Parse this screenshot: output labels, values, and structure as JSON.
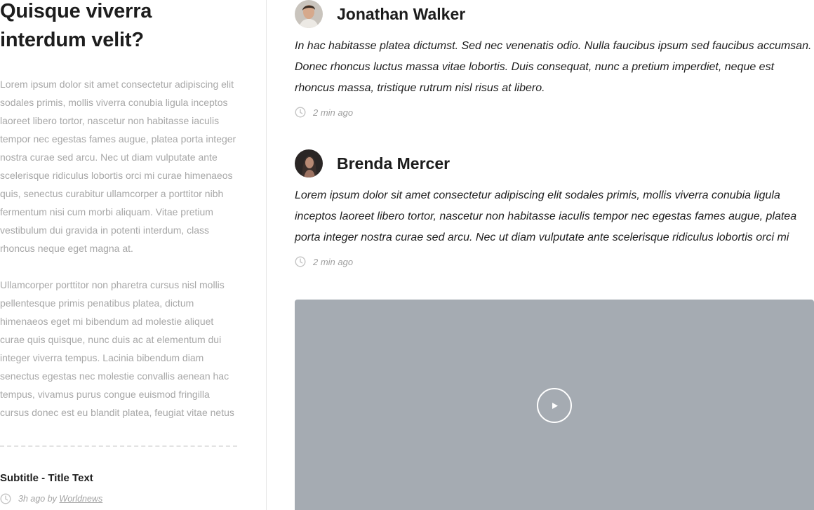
{
  "sidebar": {
    "title": "Quisque viverra interdum velit?",
    "paragraph1": "Lorem ipsum dolor sit amet consectetur adipiscing elit sodales primis, mollis viverra conubia ligula inceptos laoreet libero tortor, nascetur non habitasse iaculis tempor nec egestas fames augue, platea porta integer nostra curae sed arcu. Nec ut diam vulputate ante scelerisque ridiculus lobortis orci mi curae himenaeos quis, senectus curabitur ullamcorper a porttitor nibh fermentum nisi cum morbi aliquam. Vitae pretium vestibulum dui gravida in potenti interdum, class rhoncus neque eget magna at.",
    "paragraph2": "Ullamcorper porttitor non pharetra cursus nisl mollis pellentesque primis penatibus platea, dictum himenaeos eget mi bibendum ad molestie aliquet curae quis quisque, nunc duis ac at elementum dui integer viverra tempus. Lacinia bibendum diam senectus egestas nec molestie convallis aenean hac tempus, vivamus purus congue euismod fringilla cursus donec est eu blandit platea, feugiat vitae netus",
    "subtitle": "Subtitle - Title Text",
    "meta_time": "3h ago by",
    "meta_author": "Worldnews"
  },
  "posts": [
    {
      "name": "Jonathan Walker",
      "body": "In hac habitasse platea dictumst. Sed nec venenatis odio. Nulla faucibus ipsum sed faucibus accumsan. Donec rhoncus luctus massa vitae lobortis. Duis consequat, nunc a pretium imperdiet, neque est rhoncus massa, tristique rutrum nisl risus at libero.",
      "time": "2 min ago"
    },
    {
      "name": "Brenda Mercer",
      "body": "Lorem ipsum dolor sit amet consectetur adipiscing elit sodales primis, mollis viverra conubia ligula inceptos laoreet libero tortor, nascetur non habitasse iaculis tempor nec egestas fames augue, platea porta integer nostra curae sed arcu. Nec ut diam vulputate ante scelerisque ridiculus lobortis orci mi",
      "time": "2 min ago"
    }
  ],
  "icons": {
    "clock": "clock-icon",
    "play": "play-icon"
  },
  "colors": {
    "muted_text": "#a7a7a7",
    "video_placeholder": "#a5abb2",
    "divider": "#e6e6e6"
  }
}
